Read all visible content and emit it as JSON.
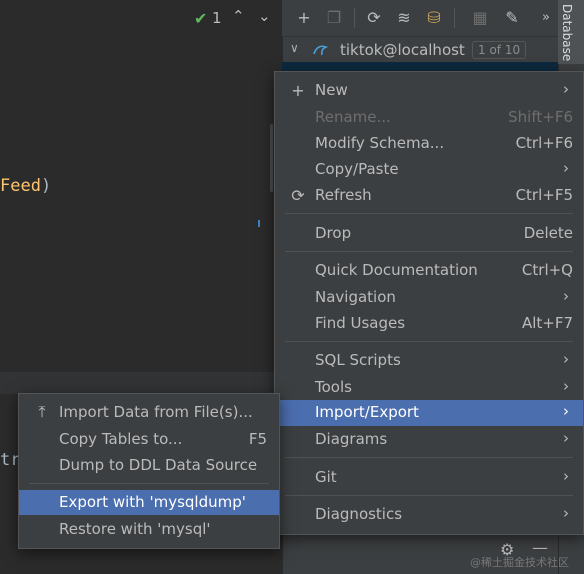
{
  "editor": {
    "code_feed_word": "Feed",
    "code_feed_paren": ")",
    "code_tr": "tr",
    "inspection_count": "1"
  },
  "db_panel": {
    "toolbar_icons": [
      "add-icon",
      "copy-icon",
      "refresh-icon",
      "schema-icon",
      "database-icon",
      "table-icon",
      "edit-icon",
      "more-icon"
    ],
    "tree": {
      "connection_label": "tiktok@localhost",
      "badge": "1 of 10"
    },
    "side_tab": "Database"
  },
  "context_menu": {
    "new": {
      "label": "New"
    },
    "rename": {
      "label": "Rename...",
      "shortcut": "Shift+F6"
    },
    "modify_schema": {
      "label": "Modify Schema...",
      "shortcut": "Ctrl+F6"
    },
    "copy_paste": {
      "label": "Copy/Paste"
    },
    "refresh": {
      "label": "Refresh",
      "shortcut": "Ctrl+F5"
    },
    "drop": {
      "label": "Drop",
      "shortcut": "Delete"
    },
    "quick_doc": {
      "label": "Quick Documentation",
      "shortcut": "Ctrl+Q"
    },
    "navigation": {
      "label": "Navigation"
    },
    "find_usages": {
      "label": "Find Usages",
      "shortcut": "Alt+F7"
    },
    "sql_scripts": {
      "label": "SQL Scripts"
    },
    "tools": {
      "label": "Tools"
    },
    "import_export": {
      "label": "Import/Export"
    },
    "diagrams": {
      "label": "Diagrams"
    },
    "git": {
      "label": "Git"
    },
    "diagnostics": {
      "label": "Diagnostics"
    }
  },
  "submenu": {
    "import_data": {
      "label": "Import Data from File(s)..."
    },
    "copy_tables": {
      "label": "Copy Tables to...",
      "shortcut": "F5"
    },
    "dump_ddl": {
      "label": "Dump to DDL Data Source"
    },
    "export_mysqldump": {
      "label": "Export with 'mysqldump'"
    },
    "restore_mysql": {
      "label": "Restore with 'mysql'"
    }
  },
  "watermark": "@稀土掘金技术社区"
}
